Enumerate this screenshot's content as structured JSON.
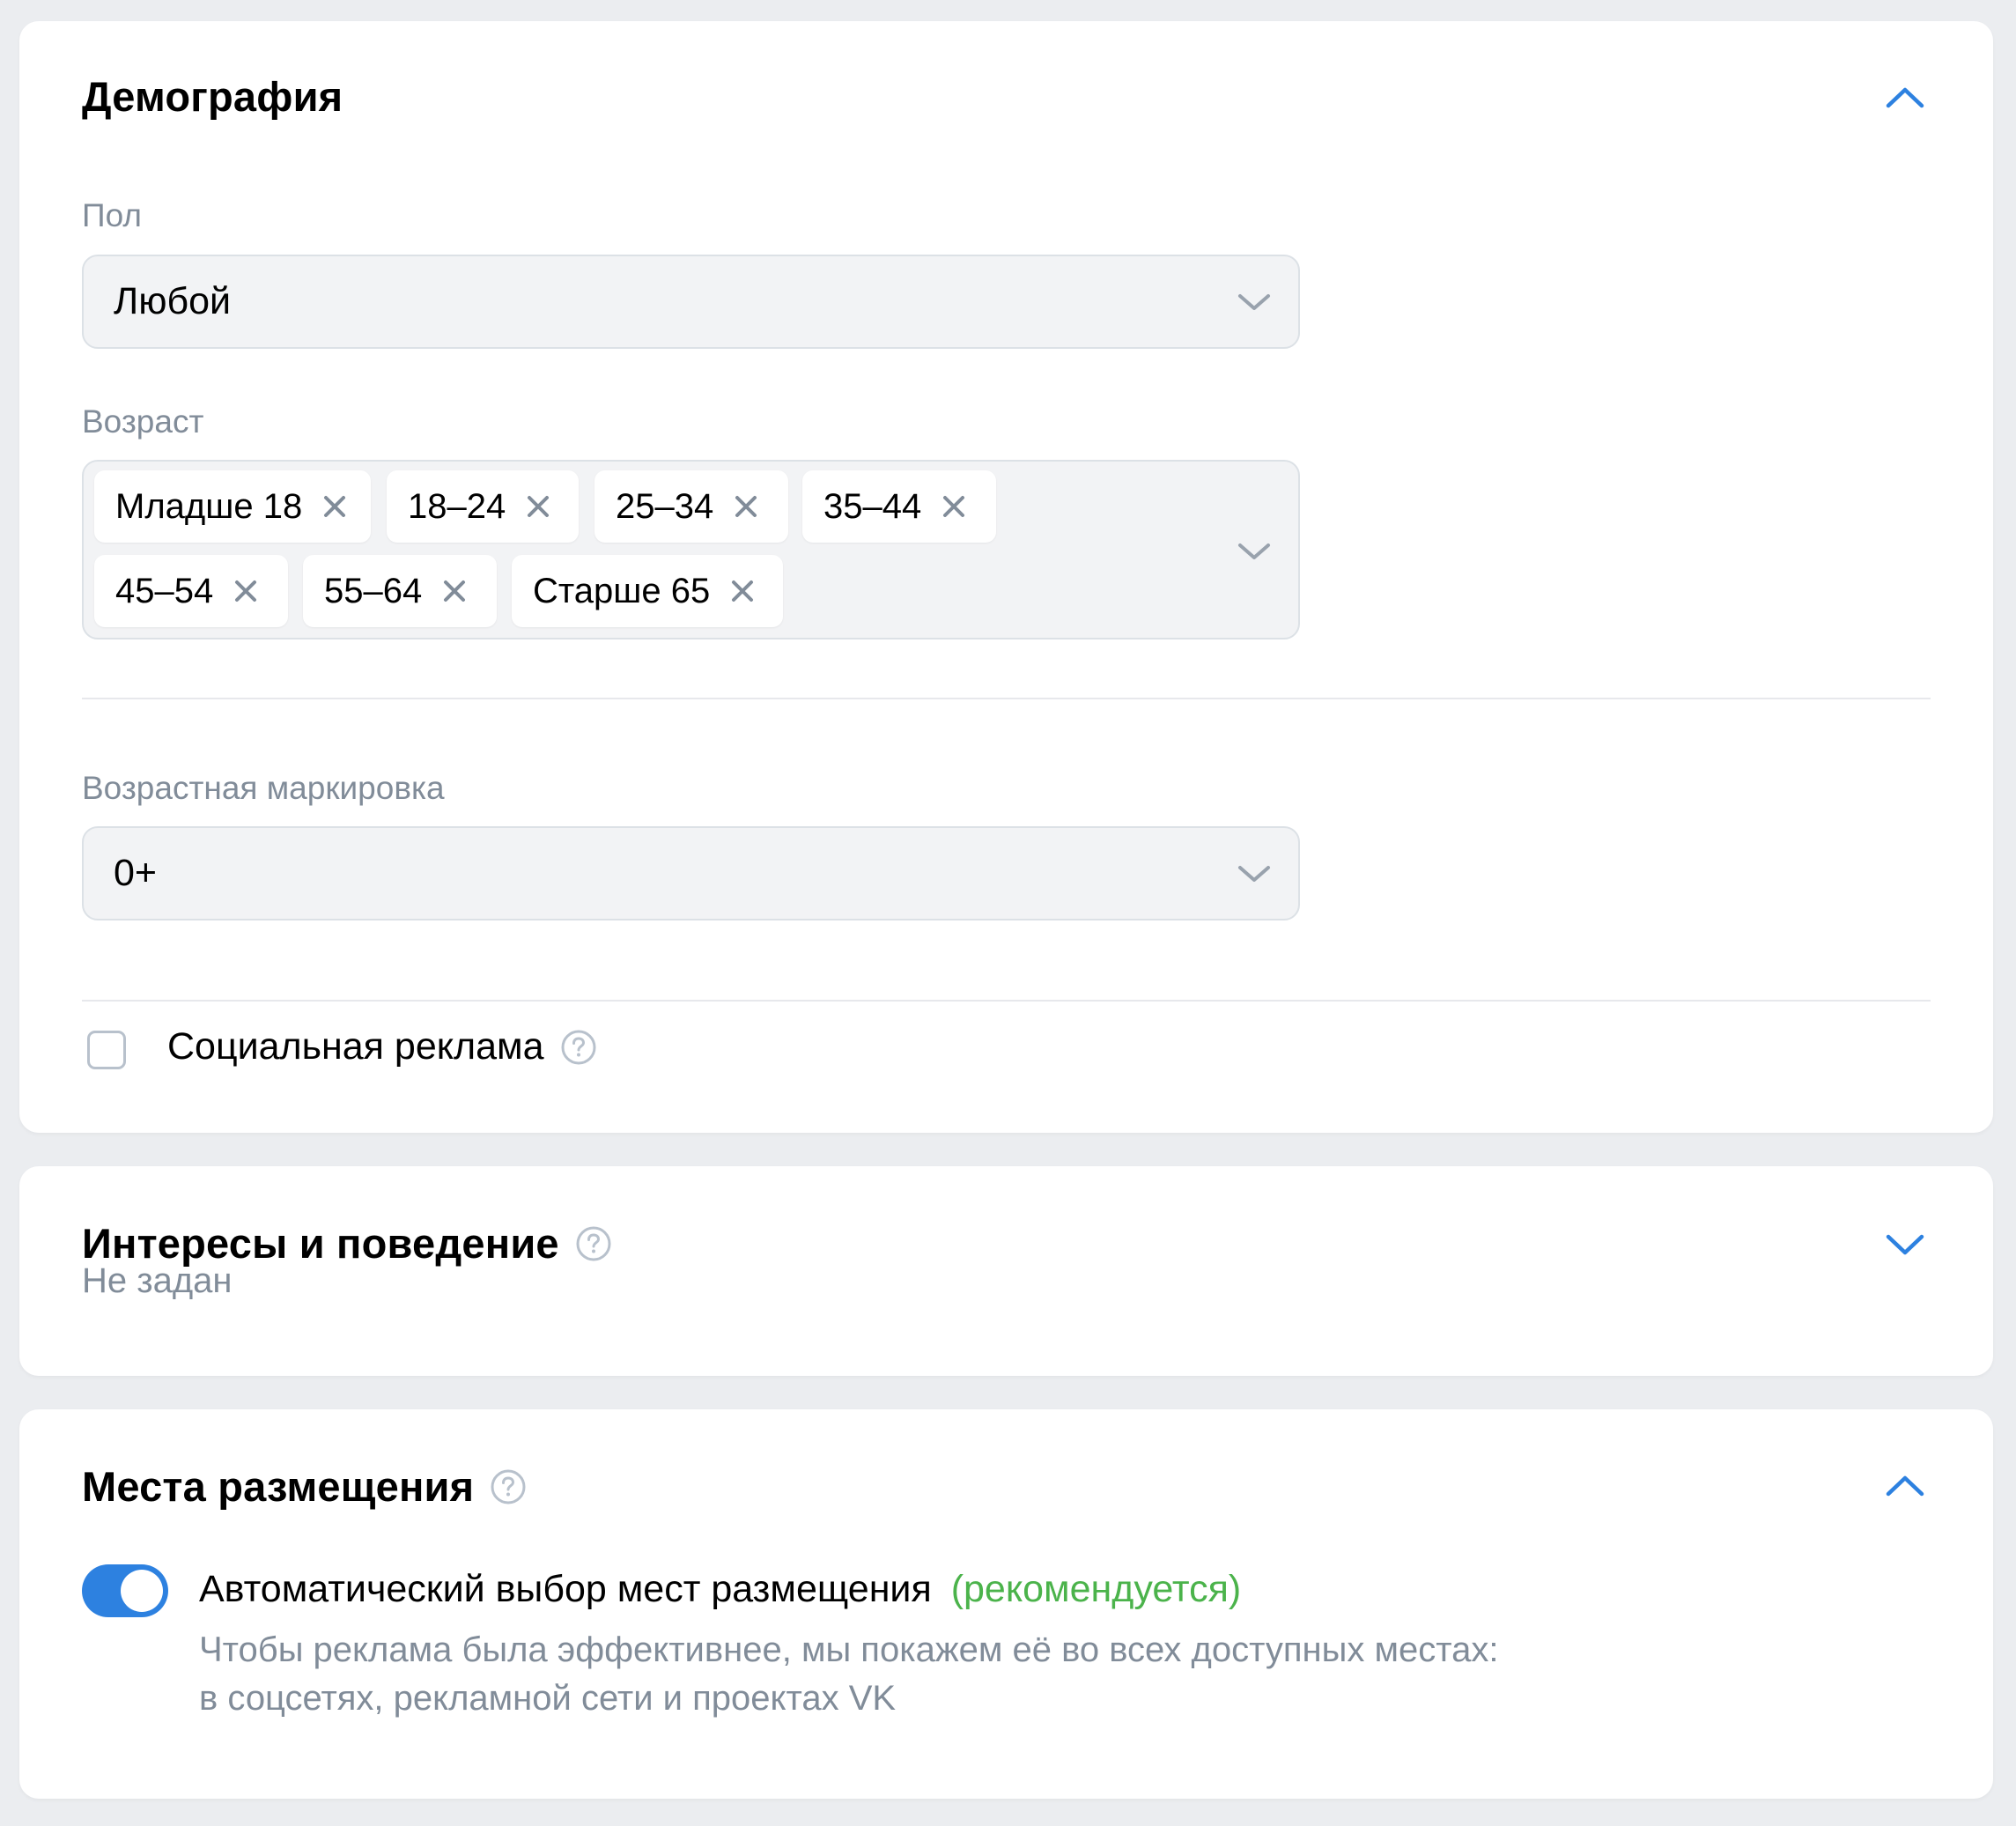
{
  "colors": {
    "accent": "#2d81e0",
    "recommended": "#4bb34b",
    "secondary_text": "#818c99",
    "page_bg": "#ebedf0"
  },
  "demography": {
    "title": "Демография",
    "collapse_icon": "chevron-up-icon",
    "gender": {
      "label": "Пол",
      "value": "Любой"
    },
    "age": {
      "label": "Возраст",
      "chips": [
        "Младше 18",
        "18–24",
        "25–34",
        "35–44",
        "45–54",
        "55–64",
        "Старше 65"
      ]
    },
    "age_rating": {
      "label": "Возрастная маркировка",
      "value": "0+"
    },
    "social_ad": {
      "label": "Социальная реклама",
      "checked": false
    }
  },
  "interests": {
    "title": "Интересы и поведение",
    "subtitle": "Не задан",
    "expand_icon": "chevron-down-icon"
  },
  "placements": {
    "title": "Места размещения",
    "collapse_icon": "chevron-up-icon",
    "auto": {
      "enabled": true,
      "label": "Автоматический выбор мест размещения",
      "recommended": "(рекомендуется)",
      "description_line1": "Чтобы реклама была эффективнее, мы покажем её во всех доступных местах:",
      "description_line2": "в соцсетях, рекламной сети и проектах VK"
    }
  }
}
